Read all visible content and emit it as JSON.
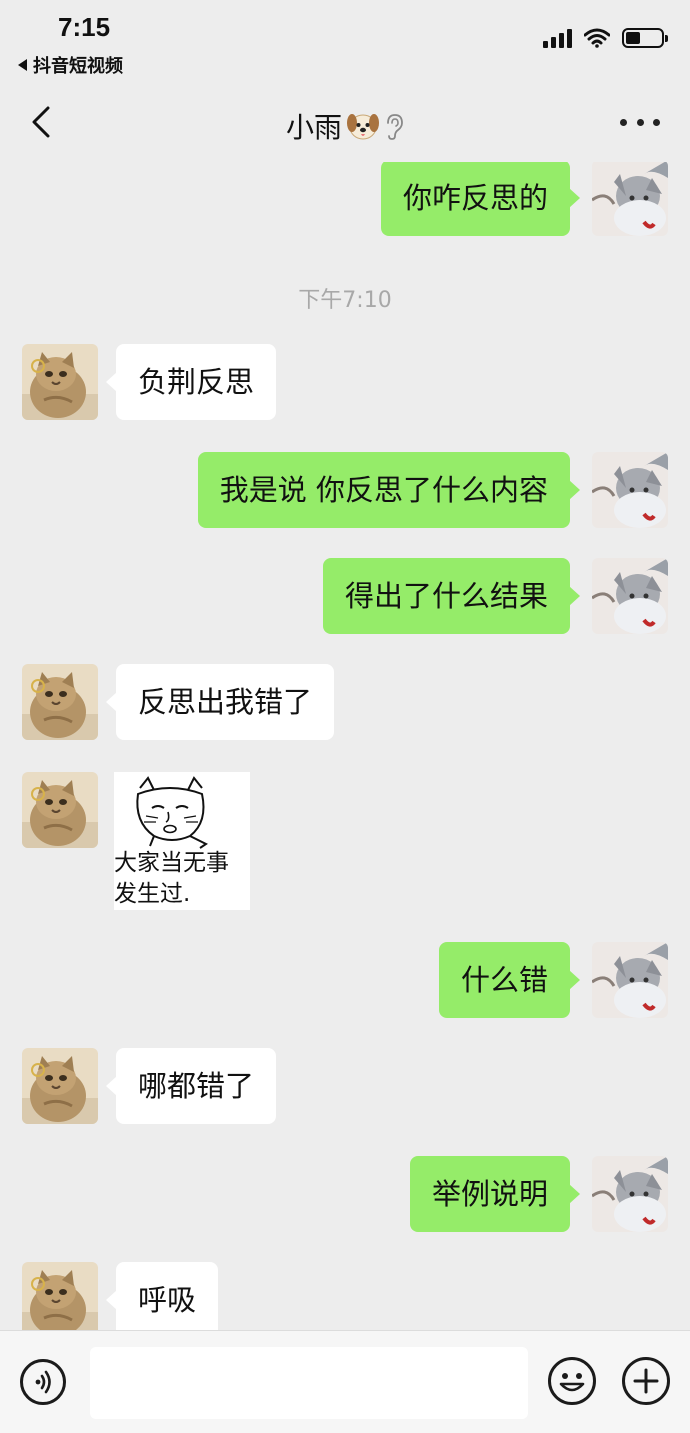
{
  "status_bar": {
    "time": "7:15",
    "back_app_label": "抖音短视频"
  },
  "nav": {
    "title": "小雨",
    "title_emoji": "dog-face-emoji",
    "mute_icon": "ear-icon",
    "more_icon": "more-dots-icon"
  },
  "messages": [
    {
      "side": "me",
      "text": "你咋反思的"
    },
    {
      "type": "timestamp",
      "text": "下午7:10"
    },
    {
      "side": "them",
      "text": "负荆反思"
    },
    {
      "side": "me",
      "text": "我是说 你反思了什么内容"
    },
    {
      "side": "me",
      "text": "得出了什么结果"
    },
    {
      "side": "them",
      "text": "反思出我错了"
    },
    {
      "side": "them",
      "type": "sticker",
      "caption_line1": "大家当无事",
      "caption_line2": "发生过."
    },
    {
      "side": "me",
      "text": "什么错"
    },
    {
      "side": "them",
      "text": "哪都错了"
    },
    {
      "side": "me",
      "text": "举例说明"
    },
    {
      "side": "them",
      "text": "呼吸"
    }
  ],
  "input_bar": {
    "voice_icon": "voice-icon",
    "emoji_icon": "smiley-icon",
    "plus_icon": "plus-icon",
    "input_value": ""
  },
  "colors": {
    "background": "#ededed",
    "my_bubble": "#95ec69",
    "their_bubble": "#ffffff",
    "timestamp": "#a8a8a8"
  }
}
